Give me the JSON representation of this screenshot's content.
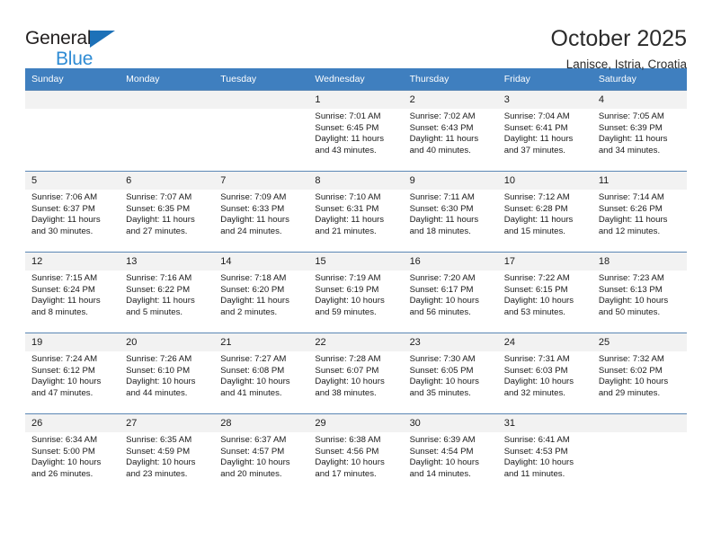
{
  "brand": {
    "name_part1": "General",
    "name_part2": "Blue",
    "triangle_icon": "triangle-icon",
    "accent_color": "#1d71b8",
    "secondary_color": "#2e8bd4"
  },
  "header": {
    "title": "October 2025",
    "subtitle": "Lanisce, Istria, Croatia"
  },
  "calendar": {
    "header_bg": "#3f7fbf",
    "header_text_color": "#ffffff",
    "daynum_bg": "#f2f2f2",
    "row_separator_color": "#5b87b5",
    "weekday_headers": [
      "Sunday",
      "Monday",
      "Tuesday",
      "Wednesday",
      "Thursday",
      "Friday",
      "Saturday"
    ],
    "weeks": [
      [
        {
          "day": "",
          "sunrise": "",
          "sunset": "",
          "daylight": ""
        },
        {
          "day": "",
          "sunrise": "",
          "sunset": "",
          "daylight": ""
        },
        {
          "day": "",
          "sunrise": "",
          "sunset": "",
          "daylight": ""
        },
        {
          "day": "1",
          "sunrise": "Sunrise: 7:01 AM",
          "sunset": "Sunset: 6:45 PM",
          "daylight": "Daylight: 11 hours and 43 minutes."
        },
        {
          "day": "2",
          "sunrise": "Sunrise: 7:02 AM",
          "sunset": "Sunset: 6:43 PM",
          "daylight": "Daylight: 11 hours and 40 minutes."
        },
        {
          "day": "3",
          "sunrise": "Sunrise: 7:04 AM",
          "sunset": "Sunset: 6:41 PM",
          "daylight": "Daylight: 11 hours and 37 minutes."
        },
        {
          "day": "4",
          "sunrise": "Sunrise: 7:05 AM",
          "sunset": "Sunset: 6:39 PM",
          "daylight": "Daylight: 11 hours and 34 minutes."
        }
      ],
      [
        {
          "day": "5",
          "sunrise": "Sunrise: 7:06 AM",
          "sunset": "Sunset: 6:37 PM",
          "daylight": "Daylight: 11 hours and 30 minutes."
        },
        {
          "day": "6",
          "sunrise": "Sunrise: 7:07 AM",
          "sunset": "Sunset: 6:35 PM",
          "daylight": "Daylight: 11 hours and 27 minutes."
        },
        {
          "day": "7",
          "sunrise": "Sunrise: 7:09 AM",
          "sunset": "Sunset: 6:33 PM",
          "daylight": "Daylight: 11 hours and 24 minutes."
        },
        {
          "day": "8",
          "sunrise": "Sunrise: 7:10 AM",
          "sunset": "Sunset: 6:31 PM",
          "daylight": "Daylight: 11 hours and 21 minutes."
        },
        {
          "day": "9",
          "sunrise": "Sunrise: 7:11 AM",
          "sunset": "Sunset: 6:30 PM",
          "daylight": "Daylight: 11 hours and 18 minutes."
        },
        {
          "day": "10",
          "sunrise": "Sunrise: 7:12 AM",
          "sunset": "Sunset: 6:28 PM",
          "daylight": "Daylight: 11 hours and 15 minutes."
        },
        {
          "day": "11",
          "sunrise": "Sunrise: 7:14 AM",
          "sunset": "Sunset: 6:26 PM",
          "daylight": "Daylight: 11 hours and 12 minutes."
        }
      ],
      [
        {
          "day": "12",
          "sunrise": "Sunrise: 7:15 AM",
          "sunset": "Sunset: 6:24 PM",
          "daylight": "Daylight: 11 hours and 8 minutes."
        },
        {
          "day": "13",
          "sunrise": "Sunrise: 7:16 AM",
          "sunset": "Sunset: 6:22 PM",
          "daylight": "Daylight: 11 hours and 5 minutes."
        },
        {
          "day": "14",
          "sunrise": "Sunrise: 7:18 AM",
          "sunset": "Sunset: 6:20 PM",
          "daylight": "Daylight: 11 hours and 2 minutes."
        },
        {
          "day": "15",
          "sunrise": "Sunrise: 7:19 AM",
          "sunset": "Sunset: 6:19 PM",
          "daylight": "Daylight: 10 hours and 59 minutes."
        },
        {
          "day": "16",
          "sunrise": "Sunrise: 7:20 AM",
          "sunset": "Sunset: 6:17 PM",
          "daylight": "Daylight: 10 hours and 56 minutes."
        },
        {
          "day": "17",
          "sunrise": "Sunrise: 7:22 AM",
          "sunset": "Sunset: 6:15 PM",
          "daylight": "Daylight: 10 hours and 53 minutes."
        },
        {
          "day": "18",
          "sunrise": "Sunrise: 7:23 AM",
          "sunset": "Sunset: 6:13 PM",
          "daylight": "Daylight: 10 hours and 50 minutes."
        }
      ],
      [
        {
          "day": "19",
          "sunrise": "Sunrise: 7:24 AM",
          "sunset": "Sunset: 6:12 PM",
          "daylight": "Daylight: 10 hours and 47 minutes."
        },
        {
          "day": "20",
          "sunrise": "Sunrise: 7:26 AM",
          "sunset": "Sunset: 6:10 PM",
          "daylight": "Daylight: 10 hours and 44 minutes."
        },
        {
          "day": "21",
          "sunrise": "Sunrise: 7:27 AM",
          "sunset": "Sunset: 6:08 PM",
          "daylight": "Daylight: 10 hours and 41 minutes."
        },
        {
          "day": "22",
          "sunrise": "Sunrise: 7:28 AM",
          "sunset": "Sunset: 6:07 PM",
          "daylight": "Daylight: 10 hours and 38 minutes."
        },
        {
          "day": "23",
          "sunrise": "Sunrise: 7:30 AM",
          "sunset": "Sunset: 6:05 PM",
          "daylight": "Daylight: 10 hours and 35 minutes."
        },
        {
          "day": "24",
          "sunrise": "Sunrise: 7:31 AM",
          "sunset": "Sunset: 6:03 PM",
          "daylight": "Daylight: 10 hours and 32 minutes."
        },
        {
          "day": "25",
          "sunrise": "Sunrise: 7:32 AM",
          "sunset": "Sunset: 6:02 PM",
          "daylight": "Daylight: 10 hours and 29 minutes."
        }
      ],
      [
        {
          "day": "26",
          "sunrise": "Sunrise: 6:34 AM",
          "sunset": "Sunset: 5:00 PM",
          "daylight": "Daylight: 10 hours and 26 minutes."
        },
        {
          "day": "27",
          "sunrise": "Sunrise: 6:35 AM",
          "sunset": "Sunset: 4:59 PM",
          "daylight": "Daylight: 10 hours and 23 minutes."
        },
        {
          "day": "28",
          "sunrise": "Sunrise: 6:37 AM",
          "sunset": "Sunset: 4:57 PM",
          "daylight": "Daylight: 10 hours and 20 minutes."
        },
        {
          "day": "29",
          "sunrise": "Sunrise: 6:38 AM",
          "sunset": "Sunset: 4:56 PM",
          "daylight": "Daylight: 10 hours and 17 minutes."
        },
        {
          "day": "30",
          "sunrise": "Sunrise: 6:39 AM",
          "sunset": "Sunset: 4:54 PM",
          "daylight": "Daylight: 10 hours and 14 minutes."
        },
        {
          "day": "31",
          "sunrise": "Sunrise: 6:41 AM",
          "sunset": "Sunset: 4:53 PM",
          "daylight": "Daylight: 10 hours and 11 minutes."
        },
        {
          "day": "",
          "sunrise": "",
          "sunset": "",
          "daylight": ""
        }
      ]
    ]
  }
}
